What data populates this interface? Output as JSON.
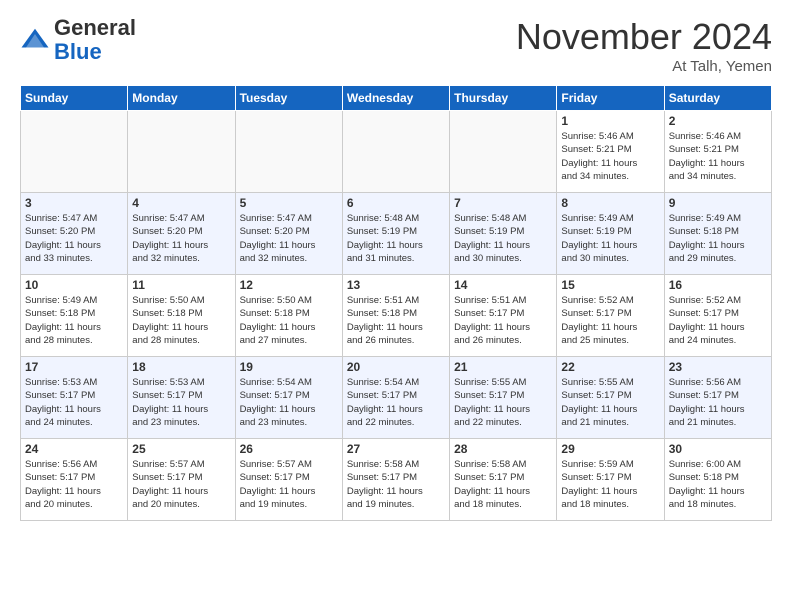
{
  "logo": {
    "general": "General",
    "blue": "Blue"
  },
  "header": {
    "month": "November 2024",
    "location": "At Talh, Yemen"
  },
  "weekdays": [
    "Sunday",
    "Monday",
    "Tuesday",
    "Wednesday",
    "Thursday",
    "Friday",
    "Saturday"
  ],
  "weeks": [
    [
      {
        "day": "",
        "info": ""
      },
      {
        "day": "",
        "info": ""
      },
      {
        "day": "",
        "info": ""
      },
      {
        "day": "",
        "info": ""
      },
      {
        "day": "",
        "info": ""
      },
      {
        "day": "1",
        "info": "Sunrise: 5:46 AM\nSunset: 5:21 PM\nDaylight: 11 hours\nand 34 minutes."
      },
      {
        "day": "2",
        "info": "Sunrise: 5:46 AM\nSunset: 5:21 PM\nDaylight: 11 hours\nand 34 minutes."
      }
    ],
    [
      {
        "day": "3",
        "info": "Sunrise: 5:47 AM\nSunset: 5:20 PM\nDaylight: 11 hours\nand 33 minutes."
      },
      {
        "day": "4",
        "info": "Sunrise: 5:47 AM\nSunset: 5:20 PM\nDaylight: 11 hours\nand 32 minutes."
      },
      {
        "day": "5",
        "info": "Sunrise: 5:47 AM\nSunset: 5:20 PM\nDaylight: 11 hours\nand 32 minutes."
      },
      {
        "day": "6",
        "info": "Sunrise: 5:48 AM\nSunset: 5:19 PM\nDaylight: 11 hours\nand 31 minutes."
      },
      {
        "day": "7",
        "info": "Sunrise: 5:48 AM\nSunset: 5:19 PM\nDaylight: 11 hours\nand 30 minutes."
      },
      {
        "day": "8",
        "info": "Sunrise: 5:49 AM\nSunset: 5:19 PM\nDaylight: 11 hours\nand 30 minutes."
      },
      {
        "day": "9",
        "info": "Sunrise: 5:49 AM\nSunset: 5:18 PM\nDaylight: 11 hours\nand 29 minutes."
      }
    ],
    [
      {
        "day": "10",
        "info": "Sunrise: 5:49 AM\nSunset: 5:18 PM\nDaylight: 11 hours\nand 28 minutes."
      },
      {
        "day": "11",
        "info": "Sunrise: 5:50 AM\nSunset: 5:18 PM\nDaylight: 11 hours\nand 28 minutes."
      },
      {
        "day": "12",
        "info": "Sunrise: 5:50 AM\nSunset: 5:18 PM\nDaylight: 11 hours\nand 27 minutes."
      },
      {
        "day": "13",
        "info": "Sunrise: 5:51 AM\nSunset: 5:18 PM\nDaylight: 11 hours\nand 26 minutes."
      },
      {
        "day": "14",
        "info": "Sunrise: 5:51 AM\nSunset: 5:17 PM\nDaylight: 11 hours\nand 26 minutes."
      },
      {
        "day": "15",
        "info": "Sunrise: 5:52 AM\nSunset: 5:17 PM\nDaylight: 11 hours\nand 25 minutes."
      },
      {
        "day": "16",
        "info": "Sunrise: 5:52 AM\nSunset: 5:17 PM\nDaylight: 11 hours\nand 24 minutes."
      }
    ],
    [
      {
        "day": "17",
        "info": "Sunrise: 5:53 AM\nSunset: 5:17 PM\nDaylight: 11 hours\nand 24 minutes."
      },
      {
        "day": "18",
        "info": "Sunrise: 5:53 AM\nSunset: 5:17 PM\nDaylight: 11 hours\nand 23 minutes."
      },
      {
        "day": "19",
        "info": "Sunrise: 5:54 AM\nSunset: 5:17 PM\nDaylight: 11 hours\nand 23 minutes."
      },
      {
        "day": "20",
        "info": "Sunrise: 5:54 AM\nSunset: 5:17 PM\nDaylight: 11 hours\nand 22 minutes."
      },
      {
        "day": "21",
        "info": "Sunrise: 5:55 AM\nSunset: 5:17 PM\nDaylight: 11 hours\nand 22 minutes."
      },
      {
        "day": "22",
        "info": "Sunrise: 5:55 AM\nSunset: 5:17 PM\nDaylight: 11 hours\nand 21 minutes."
      },
      {
        "day": "23",
        "info": "Sunrise: 5:56 AM\nSunset: 5:17 PM\nDaylight: 11 hours\nand 21 minutes."
      }
    ],
    [
      {
        "day": "24",
        "info": "Sunrise: 5:56 AM\nSunset: 5:17 PM\nDaylight: 11 hours\nand 20 minutes."
      },
      {
        "day": "25",
        "info": "Sunrise: 5:57 AM\nSunset: 5:17 PM\nDaylight: 11 hours\nand 20 minutes."
      },
      {
        "day": "26",
        "info": "Sunrise: 5:57 AM\nSunset: 5:17 PM\nDaylight: 11 hours\nand 19 minutes."
      },
      {
        "day": "27",
        "info": "Sunrise: 5:58 AM\nSunset: 5:17 PM\nDaylight: 11 hours\nand 19 minutes."
      },
      {
        "day": "28",
        "info": "Sunrise: 5:58 AM\nSunset: 5:17 PM\nDaylight: 11 hours\nand 18 minutes."
      },
      {
        "day": "29",
        "info": "Sunrise: 5:59 AM\nSunset: 5:17 PM\nDaylight: 11 hours\nand 18 minutes."
      },
      {
        "day": "30",
        "info": "Sunrise: 6:00 AM\nSunset: 5:18 PM\nDaylight: 11 hours\nand 18 minutes."
      }
    ]
  ]
}
